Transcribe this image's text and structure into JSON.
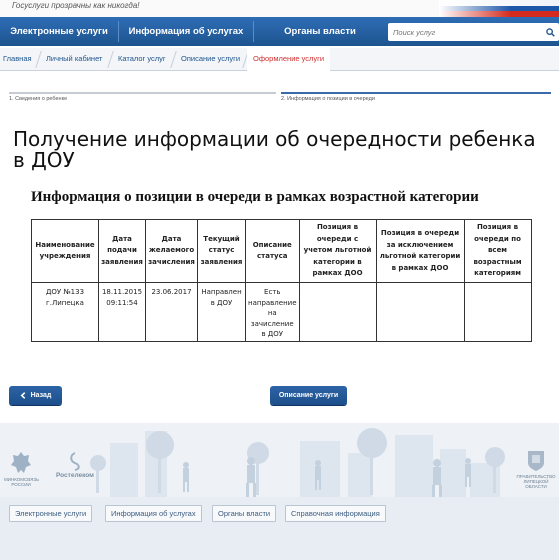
{
  "header": {
    "slogan": "Госуслуги прозрачны как никогда!"
  },
  "nav": {
    "items": [
      "Электронные услуги",
      "Информация об услугах",
      "Органы власти"
    ],
    "search_placeholder": "Поиск услуг"
  },
  "breadcrumbs": [
    "Главная",
    "Личный кабинет",
    "Каталог услуг",
    "Описание услуги",
    "Оформление услуги"
  ],
  "steps": [
    "1. Сведения о ребенке",
    "2. Информация о позиции в очереди"
  ],
  "page": {
    "title": "Получение информации об очередности ребенка в ДОУ",
    "section_title": "Информация о позиции в очереди в рамках возрастной категории"
  },
  "table": {
    "headers": [
      "Наименование учреждения",
      "Дата подачи заявления",
      "Дата желаемого зачисления",
      "Текущий статус заявления",
      "Описание статуса",
      "Позиция в очереди с учетом льготной категории в рамках ДОО",
      "Позиция в очереди за исключением льготной категории в рамках ДОО",
      "Позиция в очереди по всем возрастным категориям"
    ],
    "rows": [
      [
        "ДОУ №133 г.Липецка",
        "18.11.2015 09:11:54",
        "23.06.2017",
        "Направлен в ДОУ",
        "Есть направление на зачисление в ДОУ",
        "",
        "",
        ""
      ]
    ]
  },
  "buttons": {
    "back": "Назад",
    "service_description": "Описание услуги"
  },
  "footer": {
    "logos": [
      "МИНКОМСВЯЗЬ РОССИИ",
      "Ростелеком",
      "ПРАВИТЕЛЬСТВО ЛИПЕЦКОЙ ОБЛАСТИ"
    ],
    "links": [
      "Электронные услуги",
      "Информация об услугах",
      "Органы власти",
      "Справочная информация"
    ]
  },
  "colors": {
    "nav_blue": "#1d548f",
    "active_crumb": "#d0312d",
    "button_blue": "#2d64a6"
  }
}
